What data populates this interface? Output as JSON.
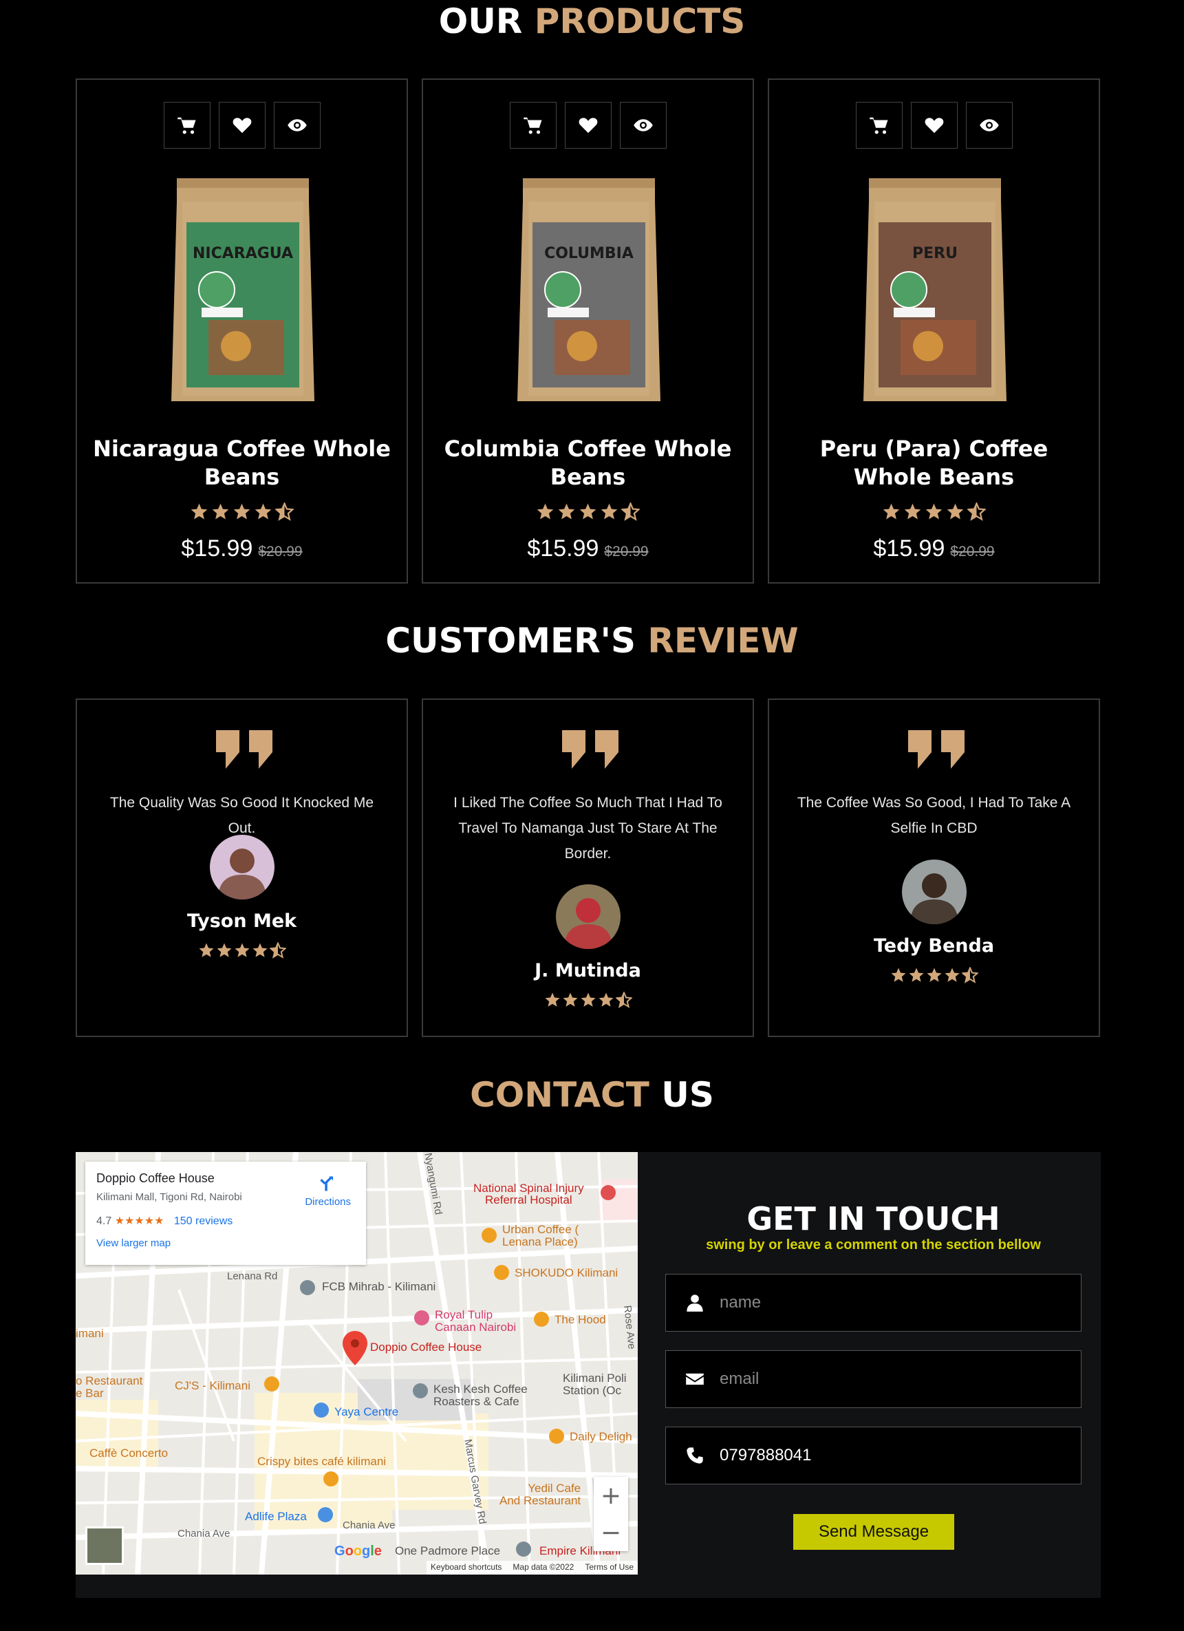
{
  "products_heading": {
    "part1": "OUR",
    "part2": "PRODUCTS"
  },
  "products": [
    {
      "name": "Nicaragua Coffee Whole Beans",
      "bag_label": "NICARAGUA",
      "price": "$15.99",
      "old_price": "$20.99",
      "rating": 4.5,
      "bag_color": "#3f8a5a"
    },
    {
      "name": "Columbia Coffee Whole Beans",
      "bag_label": "COLUMBIA",
      "price": "$15.99",
      "old_price": "$20.99",
      "rating": 4.5,
      "bag_color": "#6e6e6e"
    },
    {
      "name": "Peru (Para) Coffee Whole Beans",
      "bag_label": "PERU",
      "price": "$15.99",
      "old_price": "$20.99",
      "rating": 4.5,
      "bag_color": "#7a5240"
    }
  ],
  "reviews_heading": {
    "part1": "CUSTOMER'S",
    "part2": "REVIEW"
  },
  "reviews": [
    {
      "text": "The Quality Was So Good It Knocked Me Out.",
      "name": "Tyson Mek",
      "rating": 4.5
    },
    {
      "text": "I Liked The Coffee So Much That I Had To Travel To Namanga Just To Stare At The Border.",
      "name": "J. Mutinda",
      "rating": 4.5
    },
    {
      "text": "The Coffee Was So Good, I Had To Take A Selfie In CBD",
      "name": "Tedy Benda",
      "rating": 4.5
    }
  ],
  "contact_heading": {
    "part1": "CONTACT",
    "part2": "US"
  },
  "map": {
    "place_name": "Doppio Coffee House",
    "address": "Kilimani Mall, Tigoni Rd, Nairobi",
    "rating": "4.7",
    "rating_stars": "★★★★★",
    "reviews_link": "150 reviews",
    "view_larger": "View larger map",
    "directions": "Directions",
    "labels": {
      "spinal": "National Spinal Injury\nReferral Hospital",
      "urban": "Urban Coffee (\nLenana Place)",
      "lenana_rd": "Lenana Rd",
      "fcb": "FCB Mihrab - Kilimani",
      "shokudo": "SHOKUDO Kilimani",
      "tulip": "Royal Tulip\nCanaan Nairobi",
      "hood": "The Hood",
      "doppio": "Doppio Coffee House",
      "kilimani_left": "imani",
      "restaurant": "o Restaurant\ne Bar",
      "cjs": "CJ'S - Kilimani",
      "keshkesh": "Kesh Kesh Coffee\nRoasters & Cafe",
      "police": "Kilimani Poli\nStation (Oc",
      "yaya": "Yaya Centre",
      "daily": "Daily Deligh",
      "concerto": "Caffè Concerto",
      "crispy": "Crispy bites café kilimani",
      "yedil": "Yedil Cafe\nAnd Restaurant",
      "adlife": "Adlife Plaza",
      "chania1": "Chania Ave",
      "chania2": "Chania Ave",
      "padmore": "One Padmore Place",
      "empire": "Empire Kilimani",
      "marcus": "Marcus Garvey Rd",
      "ngumo": "Nyangumi Rd",
      "rose": "Rose Ave",
      "google": "Google",
      "shortcuts": "Keyboard shortcuts",
      "mapdata": "Map data ©2022",
      "terms": "Terms of Use",
      "kilimani_top": "Kilimani"
    }
  },
  "form": {
    "title": "GET IN TOUCH",
    "subtitle": "swing by or leave a comment on the section bellow",
    "name_placeholder": "name",
    "email_placeholder": "email",
    "phone_value": "0797888041",
    "send_label": "Send Message"
  },
  "colors": {
    "accent": "#d2a77a",
    "button": "#c7c900",
    "star": "#d2a77a"
  }
}
